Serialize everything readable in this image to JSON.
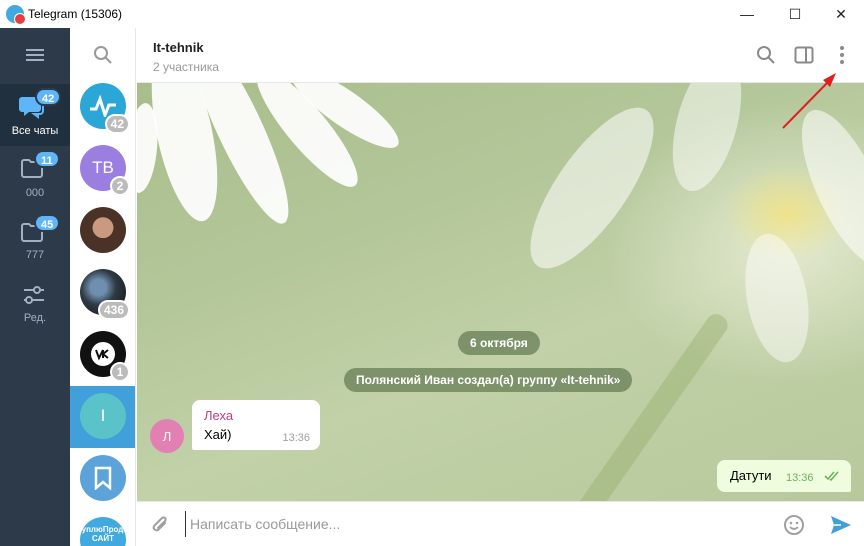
{
  "window": {
    "title": "Telegram (15306)",
    "minimize_glyph": "—",
    "maximize_glyph": "☐",
    "close_glyph": "✕"
  },
  "folders": [
    {
      "label": "Все чаты",
      "badge": "42",
      "icon": "chats-icon",
      "active": true
    },
    {
      "label": "000",
      "badge": "11",
      "icon": "folder-icon",
      "active": false
    },
    {
      "label": "777",
      "badge": "45",
      "icon": "folder-icon",
      "active": false
    },
    {
      "label": "Ред.",
      "badge": "",
      "icon": "sliders-icon",
      "active": false
    }
  ],
  "chats": [
    {
      "initials": "",
      "badge": "42",
      "color": "#2aa6d7"
    },
    {
      "initials": "TB",
      "badge": "2",
      "color": "#9a7fe0"
    },
    {
      "initials": "",
      "badge": "",
      "color": "#5b4a3e"
    },
    {
      "initials": "",
      "badge": "436",
      "color": "#2f3a45"
    },
    {
      "initials": "",
      "badge": "1",
      "color": "#111111"
    },
    {
      "initials": "I",
      "badge": "",
      "color": "#5ac2c9",
      "active": true
    },
    {
      "initials": "",
      "badge": "",
      "color": "#5ba3d8"
    },
    {
      "initials": "",
      "badge": "",
      "color": "#3fa9e0",
      "partial_text": "#КуплюПродам САЙТ"
    }
  ],
  "chat": {
    "name": "It-tehnik",
    "subtitle": "2 участника"
  },
  "messages": {
    "date": "6 октября",
    "service": "Полянский Иван создал(а) группу «It-tehnik»",
    "incoming": {
      "avatar_letter": "Л",
      "sender": "Леха",
      "text": "Хай)",
      "time": "13:36"
    },
    "outgoing": {
      "text": "Датути",
      "time": "13:36"
    }
  },
  "composer": {
    "placeholder": "Написать сообщение..."
  },
  "colors": {
    "sidebar": "#2d3a4a",
    "accent": "#419fd9",
    "annotation_arrow": "#e02020"
  }
}
